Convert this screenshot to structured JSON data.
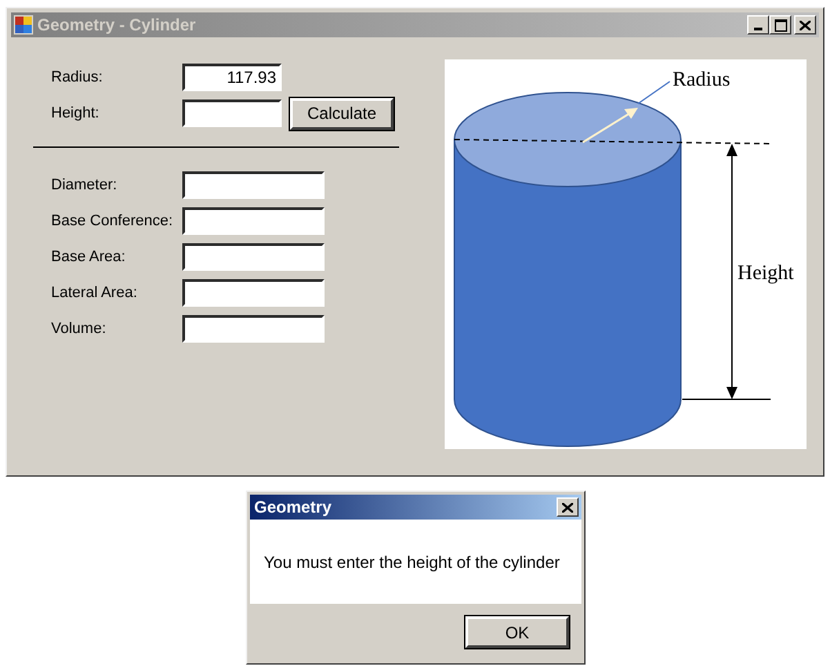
{
  "window": {
    "title": "Geometry - Cylinder"
  },
  "inputs": [
    {
      "label": "Radius:",
      "value": "117.93"
    },
    {
      "label": "Height:"
    }
  ],
  "calculate_button": {
    "label": "Calculate"
  },
  "results": [
    {
      "label": "Diameter:"
    },
    {
      "label": "Base Conference:"
    },
    {
      "label": "Base Area:"
    },
    {
      "label": "Lateral Area:"
    },
    {
      "label": "Volume:"
    }
  ],
  "diagram": {
    "radius_label": "Radius",
    "height_label": "Height"
  },
  "dialog": {
    "title": "Geometry",
    "message": "You must enter the height of the cylinder",
    "button": "OK"
  }
}
